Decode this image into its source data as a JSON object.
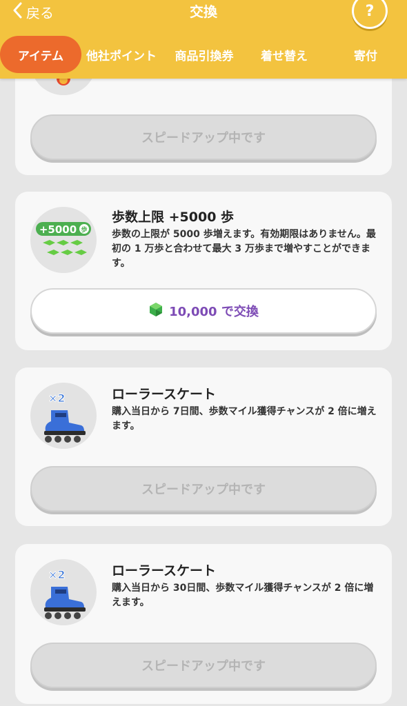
{
  "header": {
    "back_label": "戻る",
    "title": "交換",
    "help_label": "?"
  },
  "tabs": [
    {
      "label": "アイテム"
    },
    {
      "label": "他社ポイント"
    },
    {
      "label": "商品引換券"
    },
    {
      "label": "着せ替え"
    },
    {
      "label": "寄付"
    }
  ],
  "items": [
    {
      "button_label": "スピードアップ中です"
    },
    {
      "icon_text": "+5000",
      "icon_unit": "歩",
      "name": "歩数上限 +5000 歩",
      "desc": "歩数の上限が 5000 歩増えます。有効期限はありません。最初の 1 万歩と合わせて最大 3 万歩まで増やすことができます。",
      "button_label": "10,000 で交換"
    },
    {
      "icon_text": "×2",
      "name": "ローラースケート",
      "desc": "購入当日から 7日間、歩数マイル獲得チャンスが 2 倍に増えます。",
      "button_label": "スピードアップ中です"
    },
    {
      "icon_text": "×2",
      "name": "ローラースケート",
      "desc": "購入当日から 30日間、歩数マイル獲得チャンスが 2 倍に増えます。",
      "button_label": "スピードアップ中です"
    }
  ]
}
